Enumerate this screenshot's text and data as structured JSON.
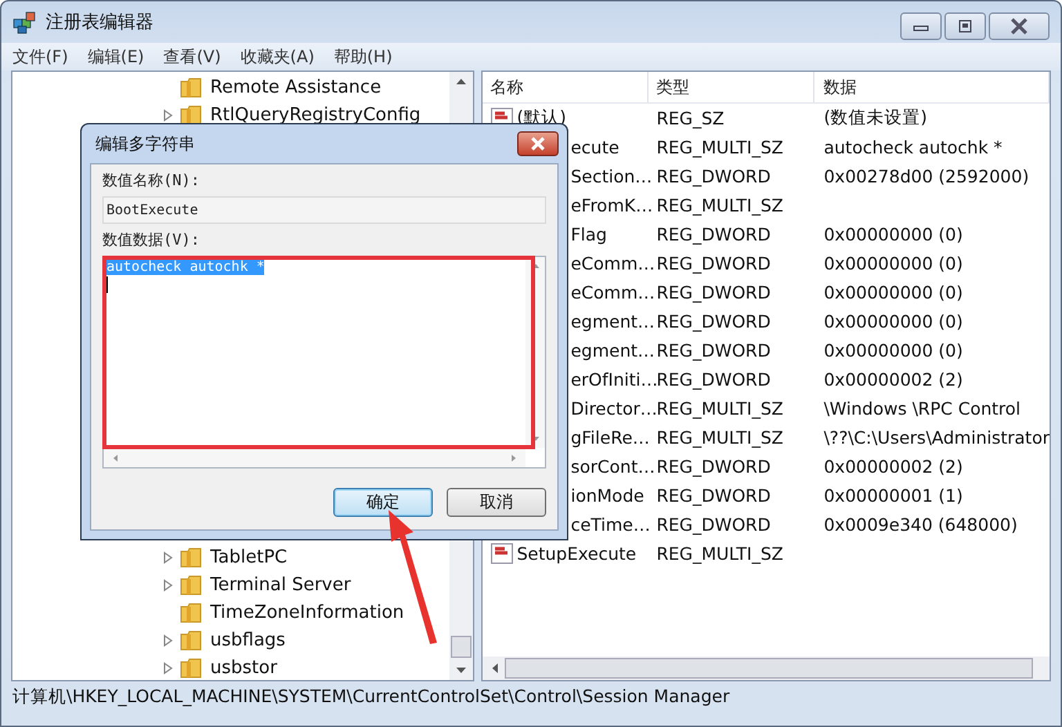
{
  "window": {
    "title": "注册表编辑器"
  },
  "menu": [
    "文件(F)",
    "编辑(E)",
    "查看(V)",
    "收藏夹(A)",
    "帮助(H)"
  ],
  "tree": {
    "top_items": [
      {
        "label": "Remote Assistance",
        "expandable": false
      },
      {
        "label": "RtlQueryRegistryConfig",
        "expandable": true
      }
    ],
    "bottom_items": [
      {
        "label": "TabletPC",
        "expandable": true
      },
      {
        "label": "Terminal Server",
        "expandable": true
      },
      {
        "label": "TimeZoneInformation",
        "expandable": false
      },
      {
        "label": "usbflags",
        "expandable": true
      },
      {
        "label": "usbstor",
        "expandable": true
      }
    ]
  },
  "table": {
    "columns": [
      "名称",
      "类型",
      "数据"
    ],
    "rows": [
      {
        "name": "(默认)",
        "covered": false,
        "type": "REG_SZ",
        "data": "(数值未设置)"
      },
      {
        "name": "ecute",
        "covered": true,
        "type": "REG_MULTI_SZ",
        "data": "autocheck autochk *"
      },
      {
        "name": "Section…",
        "covered": true,
        "type": "REG_DWORD",
        "data": "0x00278d00 (2592000)"
      },
      {
        "name": "eFromK…",
        "covered": true,
        "type": "REG_MULTI_SZ"
      },
      {
        "name": "Flag",
        "covered": true,
        "type": "REG_DWORD",
        "data": "0x00000000 (0)"
      },
      {
        "name": "eComm…",
        "covered": true,
        "type": "REG_DWORD",
        "data": "0x00000000 (0)"
      },
      {
        "name": "eComm…",
        "covered": true,
        "type": "REG_DWORD",
        "data": "0x00000000 (0)"
      },
      {
        "name": "egment…",
        "covered": true,
        "type": "REG_DWORD",
        "data": "0x00000000 (0)"
      },
      {
        "name": "egment…",
        "covered": true,
        "type": "REG_DWORD",
        "data": "0x00000000 (0)"
      },
      {
        "name": "erOfIniti…",
        "covered": true,
        "type": "REG_DWORD",
        "data": "0x00000002 (2)"
      },
      {
        "name": "Director…",
        "covered": true,
        "type": "REG_MULTI_SZ",
        "data": "\\Windows \\RPC Control"
      },
      {
        "name": "gFileRe…",
        "covered": true,
        "type": "REG_MULTI_SZ",
        "data": "\\??\\C:\\Users\\Administrator"
      },
      {
        "name": "sorCont…",
        "covered": true,
        "type": "REG_DWORD",
        "data": "0x00000002 (2)"
      },
      {
        "name": "ionMode",
        "covered": true,
        "type": "REG_DWORD",
        "data": "0x00000001 (1)"
      },
      {
        "name": "ceTime…",
        "covered": true,
        "type": "REG_DWORD",
        "data": "0x0009e340 (648000)"
      },
      {
        "name": "SetupExecute",
        "covered": false,
        "type": "REG_MULTI_SZ"
      }
    ]
  },
  "status_bar": "计算机\\HKEY_LOCAL_MACHINE\\SYSTEM\\CurrentControlSet\\Control\\Session Manager",
  "dialog": {
    "title": "编辑多字符串",
    "name_label": "数值名称(N):",
    "name_value": "BootExecute",
    "data_label": "数值数据(V):",
    "data_value": "autocheck autochk *",
    "buttons": [
      {
        "label": "确定",
        "default": true
      },
      {
        "label": "取消",
        "default": false
      }
    ]
  }
}
